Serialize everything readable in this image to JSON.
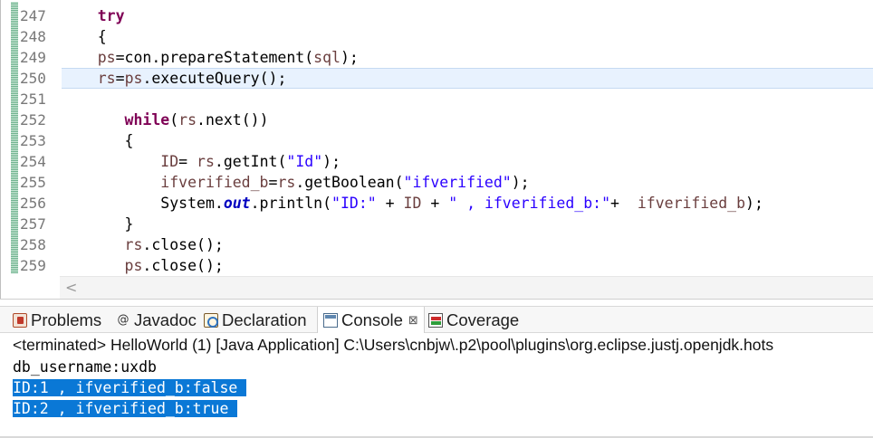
{
  "editor": {
    "line_numbers": [
      "247",
      "248",
      "249",
      "250",
      "251",
      "252",
      "253",
      "254",
      "255",
      "256",
      "257",
      "258",
      "259"
    ],
    "lines": [
      [
        {
          "t": "    "
        },
        {
          "t": "try",
          "c": "kw"
        }
      ],
      [
        {
          "t": "    {"
        }
      ],
      [
        {
          "t": "    "
        },
        {
          "t": "ps",
          "c": "var"
        },
        {
          "t": "=con.prepareStatement("
        },
        {
          "t": "sql",
          "c": "var"
        },
        {
          "t": ");"
        }
      ],
      [
        {
          "t": "    "
        },
        {
          "t": "rs",
          "c": "var"
        },
        {
          "t": "="
        },
        {
          "t": "ps",
          "c": "var"
        },
        {
          "t": ".executeQuery();"
        }
      ],
      [
        {
          "t": ""
        }
      ],
      [
        {
          "t": "       "
        },
        {
          "t": "while",
          "c": "kw"
        },
        {
          "t": "("
        },
        {
          "t": "rs",
          "c": "var"
        },
        {
          "t": ".next())"
        }
      ],
      [
        {
          "t": "       {"
        }
      ],
      [
        {
          "t": "           "
        },
        {
          "t": "ID",
          "c": "var"
        },
        {
          "t": "= "
        },
        {
          "t": "rs",
          "c": "var"
        },
        {
          "t": ".getInt("
        },
        {
          "t": "\"Id\"",
          "c": "str"
        },
        {
          "t": ");"
        }
      ],
      [
        {
          "t": "           "
        },
        {
          "t": "ifverified_b",
          "c": "var"
        },
        {
          "t": "="
        },
        {
          "t": "rs",
          "c": "var"
        },
        {
          "t": ".getBoolean("
        },
        {
          "t": "\"ifverified\"",
          "c": "str"
        },
        {
          "t": ");"
        }
      ],
      [
        {
          "t": "           System."
        },
        {
          "t": "out",
          "c": "fld"
        },
        {
          "t": ".println("
        },
        {
          "t": "\"ID:\"",
          "c": "str"
        },
        {
          "t": " + "
        },
        {
          "t": "ID",
          "c": "var"
        },
        {
          "t": " + "
        },
        {
          "t": "\" , ifverified_b:\"",
          "c": "str"
        },
        {
          "t": "+  "
        },
        {
          "t": "ifverified_b",
          "c": "var"
        },
        {
          "t": ");"
        }
      ],
      [
        {
          "t": "       }"
        }
      ],
      [
        {
          "t": "       "
        },
        {
          "t": "rs",
          "c": "var"
        },
        {
          "t": ".close();"
        }
      ],
      [
        {
          "t": "       "
        },
        {
          "t": "ps",
          "c": "var"
        },
        {
          "t": ".close();"
        }
      ]
    ],
    "current_line_index": 3,
    "scroll_left_glyph": "<"
  },
  "tabs": [
    {
      "label": "Problems",
      "icon": "problems-icon"
    },
    {
      "label": "Javadoc",
      "icon": "javadoc-icon",
      "glyph": "@"
    },
    {
      "label": "Declaration",
      "icon": "declaration-icon"
    },
    {
      "label": "Console",
      "icon": "console-icon",
      "active": true,
      "close_glyph": "⊠"
    },
    {
      "label": "Coverage",
      "icon": "coverage-icon"
    }
  ],
  "console": {
    "status": "<terminated> HelloWorld (1) [Java Application] C:\\Users\\cnbjw\\.p2\\pool\\plugins\\org.eclipse.justj.openjdk.hots",
    "output": [
      {
        "text": "db_username:uxdb",
        "selected": false
      },
      {
        "text": "ID:1 , ifverified_b:false ",
        "selected": true
      },
      {
        "text": "ID:2 , ifverified_b:true ",
        "selected": true
      }
    ]
  },
  "colors": {
    "keyword": "#7f0055",
    "local_variable": "#6a3e3e",
    "string": "#2a00ff",
    "static_field": "#0000c0",
    "current_line": "#e8f2fe",
    "selection": "#0a78d6"
  }
}
